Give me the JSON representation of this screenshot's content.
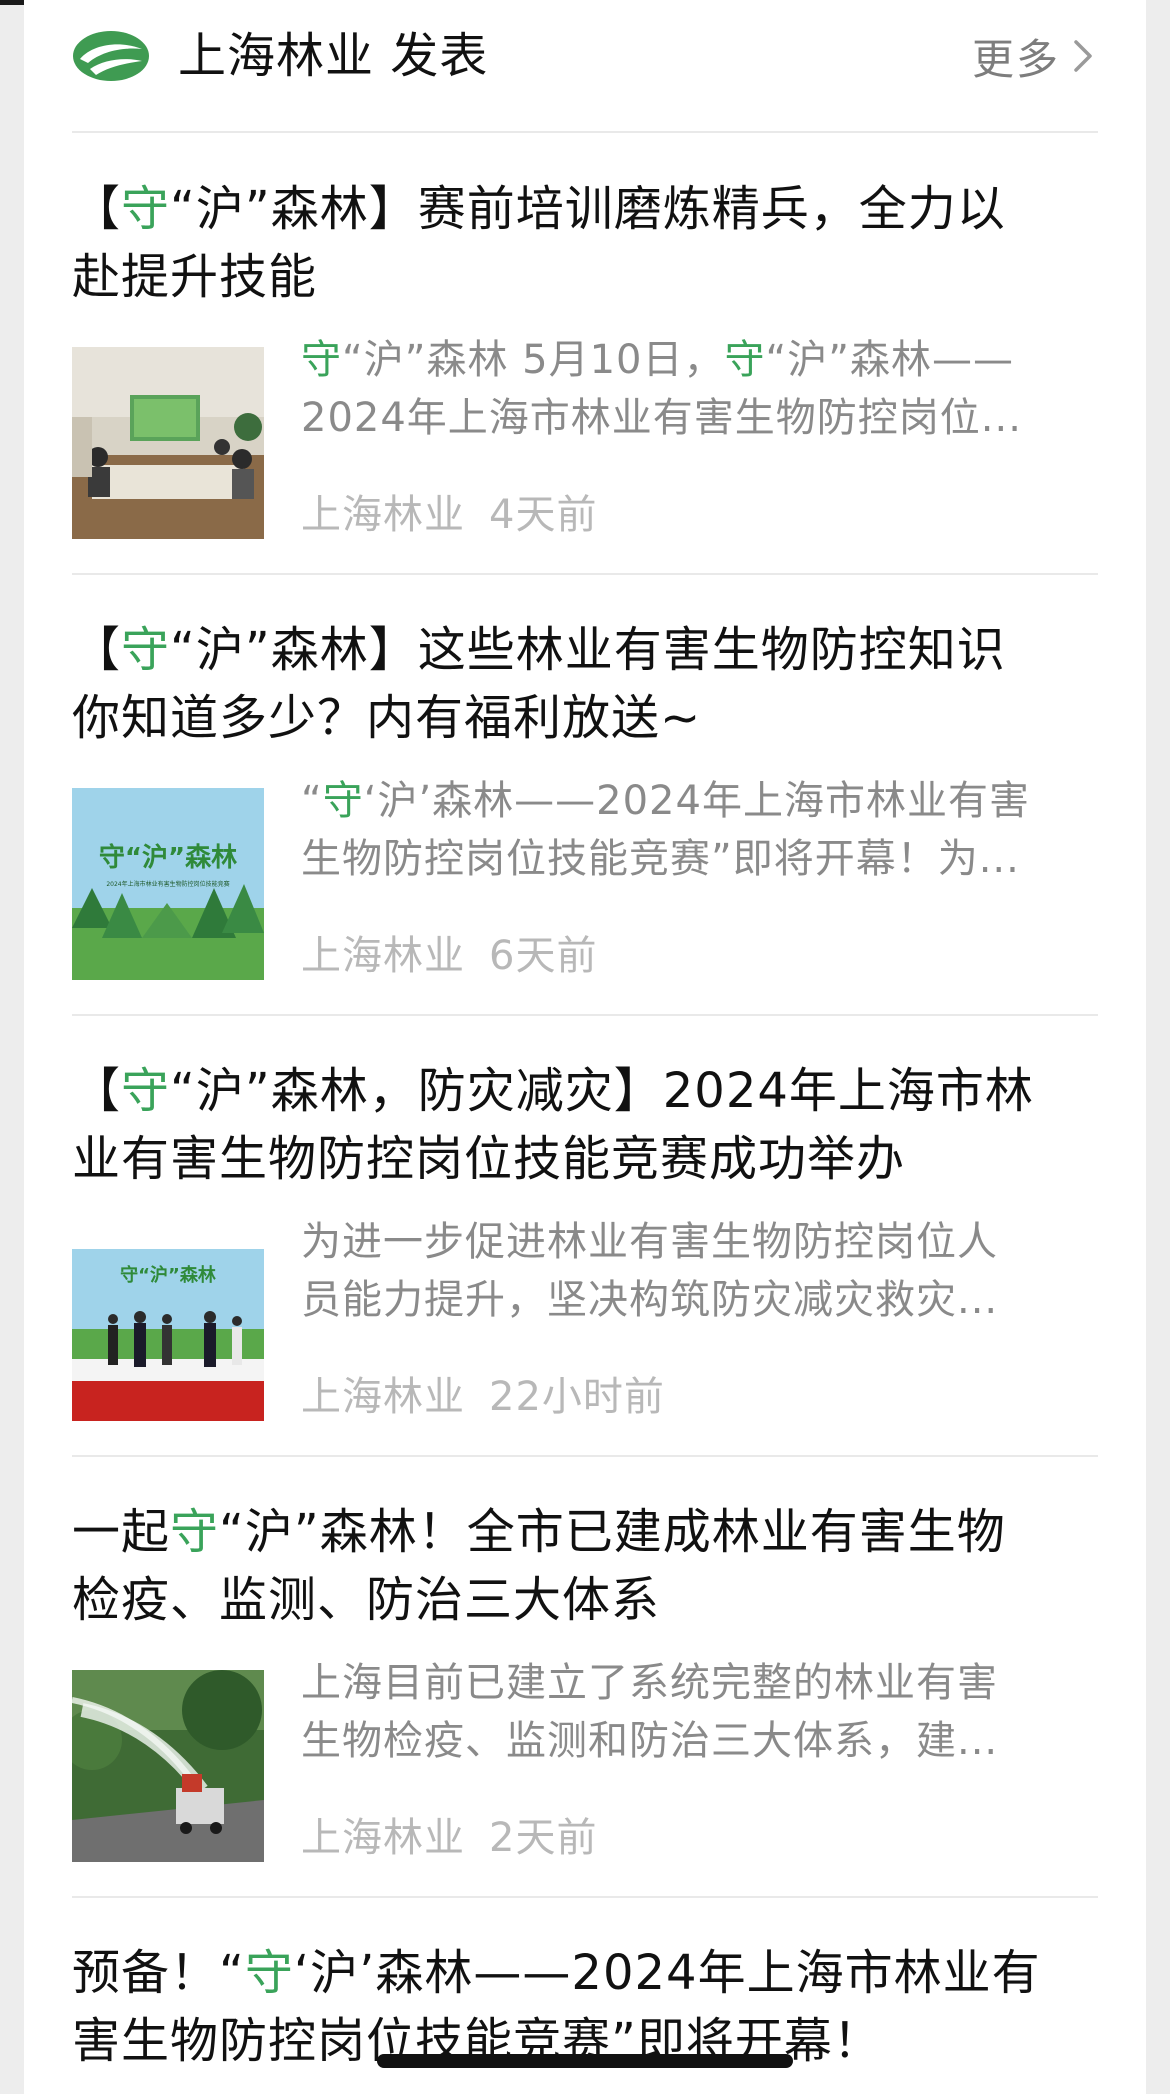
{
  "header": {
    "title": "上海林业 发表",
    "more_label": "更多",
    "logo_icon": "leaf-logo-icon"
  },
  "colors": {
    "accent_green": "#3aa35a",
    "meta_gray": "#b8b8b8",
    "summary_gray": "#8a8a8a",
    "divider": "#e9e9e9",
    "side_bg": "#ededed"
  },
  "articles": [
    {
      "title_lines": [
        [
          {
            "t": "【"
          },
          {
            "t": "守",
            "hl": true
          },
          {
            "t": "“沪”森林】赛前培训磨炼精兵，全力以"
          }
        ],
        [
          {
            "t": "赴提升技能"
          }
        ]
      ],
      "summary_lines": [
        [
          {
            "t": "守",
            "hl": true
          },
          {
            "t": "“沪”森林 5月10日，"
          },
          {
            "t": "守",
            "hl": true
          },
          {
            "t": "“沪”森林——"
          }
        ],
        [
          {
            "t": "2024年上海市林业有害生物防控岗位..."
          }
        ]
      ],
      "source": "上海林业",
      "time": "4天前",
      "thumb": "meeting-room-photo"
    },
    {
      "title_lines": [
        [
          {
            "t": "【"
          },
          {
            "t": "守",
            "hl": true
          },
          {
            "t": "“沪”森林】这些林业有害生物防控知识"
          }
        ],
        [
          {
            "t": "你知道多少？内有福利放送~"
          }
        ]
      ],
      "summary_lines": [
        [
          {
            "t": "“"
          },
          {
            "t": "守",
            "hl": true
          },
          {
            "t": "‘沪’森林——2024年上海市林业有害"
          }
        ],
        [
          {
            "t": "生物防控岗位技能竞赛”即将开幕！为..."
          }
        ]
      ],
      "source": "上海林业",
      "time": "6天前",
      "thumb": "forest-poster-image",
      "thumb_text": "守“沪”森林",
      "thumb_subtext": "2024年上海市林业有害生物防控岗位技能竞赛"
    },
    {
      "title_lines": [
        [
          {
            "t": "【"
          },
          {
            "t": "守",
            "hl": true
          },
          {
            "t": "“沪”森林，防灾减灾】2024年上海市林"
          }
        ],
        [
          {
            "t": "业有害生物防控岗位技能竞赛成功举办"
          }
        ]
      ],
      "summary_lines": [
        [
          {
            "t": "为进一步促进林业有害生物防控岗位人"
          }
        ],
        [
          {
            "t": "员能力提升，坚决构筑防灾减灾救灾..."
          }
        ]
      ],
      "source": "上海林业",
      "time": "22小时前",
      "thumb": "ceremony-stage-photo",
      "thumb_text": "守“沪”森林"
    },
    {
      "title_lines": [
        [
          {
            "t": "一起"
          },
          {
            "t": "守",
            "hl": true
          },
          {
            "t": "“沪”森林！全市已建成林业有害生物"
          }
        ],
        [
          {
            "t": "检疫、监测、防治三大体系"
          }
        ]
      ],
      "summary_lines": [
        [
          {
            "t": "上海目前已建立了系统完整的林业有害"
          }
        ],
        [
          {
            "t": "生物检疫、监测和防治三大体系，建..."
          }
        ]
      ],
      "source": "上海林业",
      "time": "2天前",
      "thumb": "spray-truck-photo"
    },
    {
      "title_lines": [
        [
          {
            "t": "预备！“"
          },
          {
            "t": "守",
            "hl": true
          },
          {
            "t": "‘沪’森林——2024年上海市林业有"
          }
        ],
        [
          {
            "t": "害生物防控岗位技能竞赛”即将开幕！"
          }
        ]
      ],
      "summary_lines": [],
      "source": "",
      "time": "",
      "thumb": ""
    }
  ]
}
